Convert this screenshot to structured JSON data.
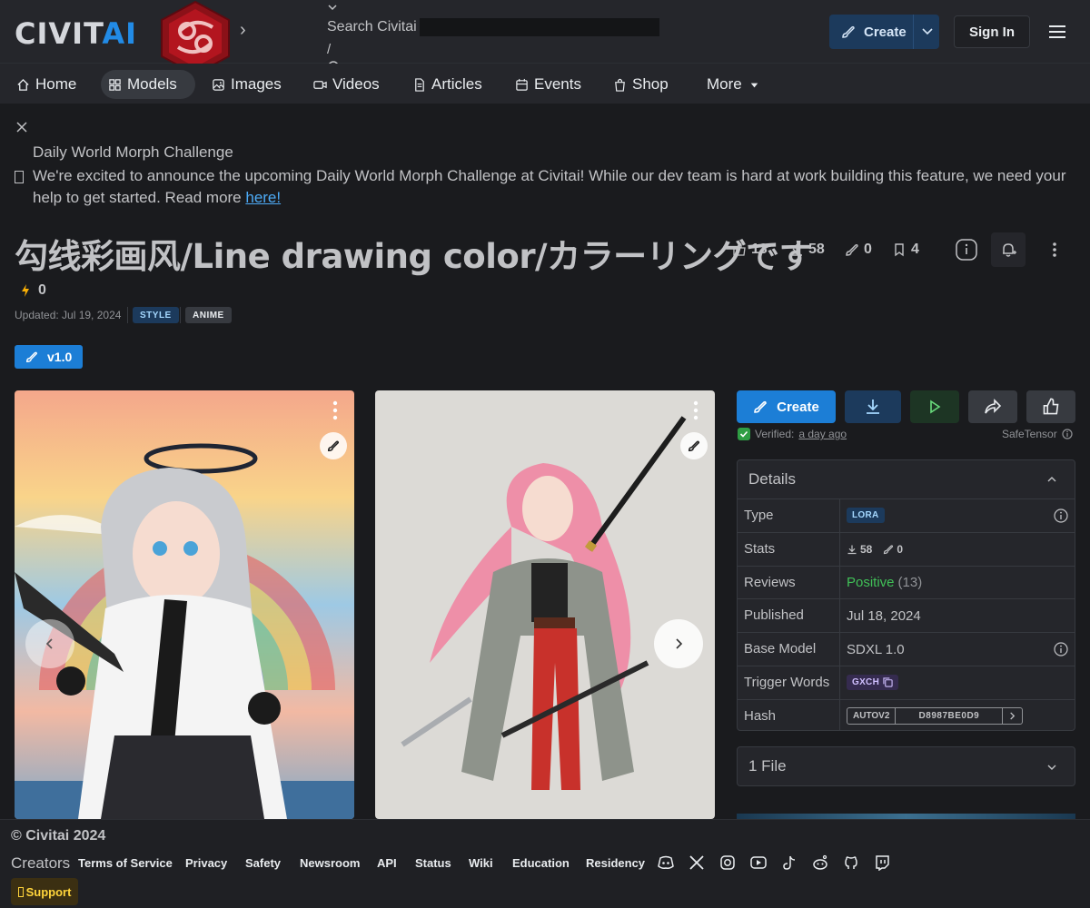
{
  "header": {
    "logo_main": "CIVIT",
    "logo_accent": "AI",
    "search_placeholder": "Search Civitai",
    "search_shortcut": "/",
    "create_label": "Create",
    "signin_label": "Sign In"
  },
  "nav": {
    "items": [
      {
        "label": "Home",
        "icon": "home-icon"
      },
      {
        "label": "Models",
        "icon": "grid-icon"
      },
      {
        "label": "Images",
        "icon": "image-icon"
      },
      {
        "label": "Videos",
        "icon": "video-icon"
      },
      {
        "label": "Articles",
        "icon": "article-icon"
      },
      {
        "label": "Events",
        "icon": "calendar-icon"
      },
      {
        "label": "Shop",
        "icon": "shopping-bag-icon"
      },
      {
        "label": "More",
        "icon": "caret-down-icon"
      }
    ],
    "active": "Models"
  },
  "announcement": {
    "title": "Daily World Morph Challenge",
    "body": "We're excited to announce the upcoming Daily World Morph Challenge at Civitai! While our dev team is hard at work building this feature, we need your help to get started. Read more ",
    "link_text": "here!"
  },
  "model": {
    "title": "勾线彩画风/Line drawing color/カラーリングです",
    "stats": {
      "likes": "13",
      "downloads": "58",
      "generations": "0",
      "bookmarks": "4"
    },
    "buzz": "0",
    "updated": "Updated: Jul 19, 2024",
    "tags": [
      "STYLE",
      "ANIME"
    ],
    "version": "v1.0"
  },
  "actions": {
    "create_label": "Create",
    "verified_label": "Verified:",
    "verified_time": "a day ago",
    "format": "SafeTensor"
  },
  "details": {
    "heading": "Details",
    "rows": {
      "type": {
        "key": "Type",
        "value": "LORA"
      },
      "stats": {
        "key": "Stats",
        "downloads": "58",
        "generations": "0"
      },
      "reviews": {
        "key": "Reviews",
        "value": "Positive",
        "count": "(13)"
      },
      "published": {
        "key": "Published",
        "value": "Jul 18, 2024"
      },
      "base_model": {
        "key": "Base Model",
        "value": "SDXL 1.0"
      },
      "trigger": {
        "key": "Trigger Words",
        "value": "GXCH"
      },
      "hash": {
        "key": "Hash",
        "algo": "AUTOV2",
        "value": "D8987BE0D9"
      }
    }
  },
  "files": {
    "label": "1 File"
  },
  "footer": {
    "copyright": "© Civitai 2024",
    "creators": "Creators",
    "links": [
      "Terms of Service",
      "Privacy",
      "Safety",
      "Newsroom",
      "API",
      "Status",
      "Wiki",
      "Education",
      "Residency"
    ],
    "support": "Support"
  },
  "colors": {
    "accent": "#228be6",
    "background": "#1a1b1e",
    "positive": "#40c057",
    "support": "#ffd43b"
  }
}
